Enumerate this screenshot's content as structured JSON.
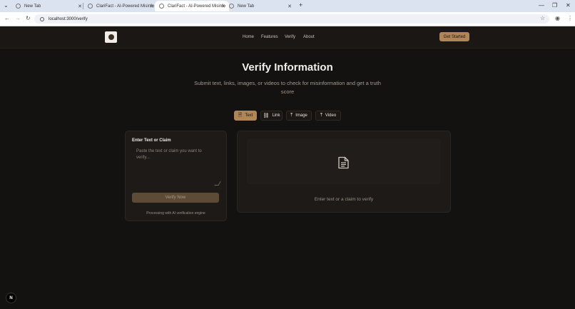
{
  "browser": {
    "tabs": [
      {
        "title": "New Tab",
        "active": false
      },
      {
        "title": "ClariFact - AI-Powered Misinfo",
        "active": false
      },
      {
        "title": "ClariFact - AI-Powered Misinfo",
        "active": true
      },
      {
        "title": "New Tab",
        "active": false
      }
    ],
    "new_tab_glyph": "+",
    "url": "localhost:3000/verify"
  },
  "header": {
    "nav": [
      "Home",
      "Features",
      "Verify",
      "About"
    ],
    "cta_label": "Get Started"
  },
  "hero": {
    "title": "Verify Information",
    "subtitle": "Submit text, links, images, or videos to check for misinformation and get a truth score"
  },
  "modes": [
    {
      "label": "Text",
      "icon": "document-icon",
      "active": true
    },
    {
      "label": "Link",
      "icon": "link-icon",
      "active": false
    },
    {
      "label": "Image",
      "icon": "upload-icon",
      "active": false
    },
    {
      "label": "Video",
      "icon": "upload-icon",
      "active": false
    }
  ],
  "input_card": {
    "title": "Enter Text or Claim",
    "placeholder": "Paste the text or claim you want to verify...",
    "value": "",
    "button_label": "Verify Now",
    "note": "Processing with AI verification engine"
  },
  "result_card": {
    "placeholder_text": "Enter text or a claim to verify"
  },
  "badge": {
    "label": "N"
  },
  "colors": {
    "accent": "#b08658",
    "background": "#141210",
    "card": "#1d1a17"
  }
}
